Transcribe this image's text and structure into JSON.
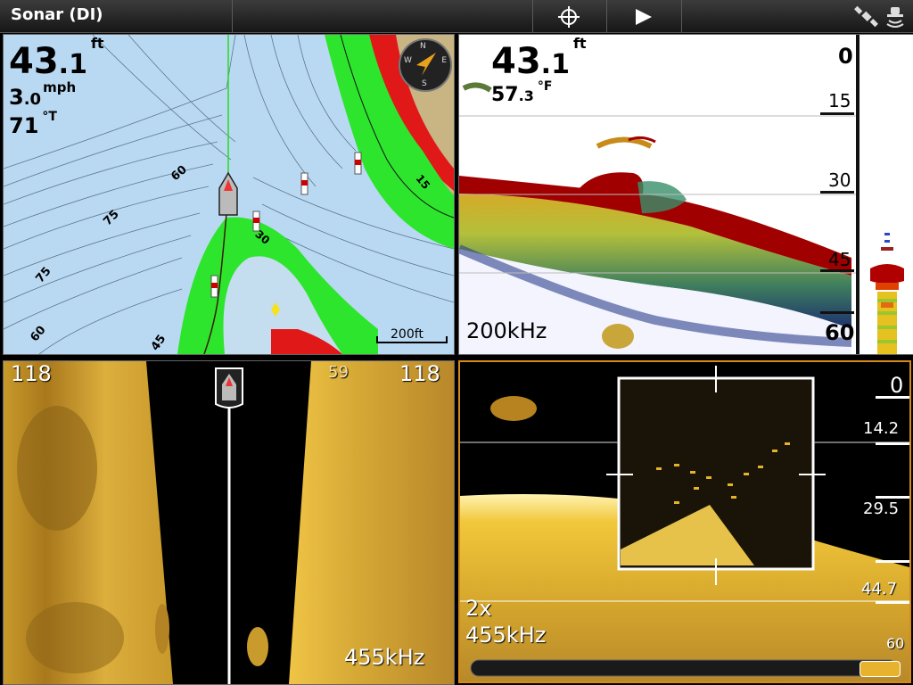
{
  "topbar": {
    "title": "Sonar (DI)",
    "icons": [
      "crosshair-icon",
      "play-icon",
      "gps-satellite-icon",
      "transducer-icon"
    ]
  },
  "chart_view": {
    "depth": {
      "value": "43",
      "decimal": ".1",
      "unit": "ft"
    },
    "speed": {
      "value": "3",
      "decimal": ".0",
      "unit": "mph"
    },
    "heading": {
      "value": "71",
      "unit": "°T"
    },
    "compass_letters": [
      "N",
      "E",
      "S",
      "W"
    ],
    "contour_labels": [
      "60",
      "75",
      "75",
      "60",
      "45",
      "30",
      "15"
    ],
    "scale_label": "200ft"
  },
  "sonar_view": {
    "depth": {
      "value": "43",
      "decimal": ".1",
      "unit": "ft"
    },
    "temperature": {
      "value": "57",
      "decimal": ".3",
      "unit": "°F"
    },
    "frequency": "200kHz",
    "depth_scale": [
      "0",
      "15",
      "30",
      "45",
      "60"
    ]
  },
  "side_imaging_view": {
    "range_left": "118",
    "range_right": "118",
    "depth_mark": "59",
    "frequency": "455kHz"
  },
  "down_imaging_view": {
    "depth_scale": [
      "0",
      "14.2",
      "29.5",
      "44.7",
      "60"
    ],
    "zoom": "2x",
    "frequency": "455kHz"
  },
  "colors": {
    "water": "#b9d9f2",
    "shallow": "#2ee52e",
    "land": "#c9b483",
    "danger": "#e01818",
    "sonar_bottom": "#a00000",
    "imaging": "#e6b02a",
    "active_border": "#d58a1a"
  }
}
